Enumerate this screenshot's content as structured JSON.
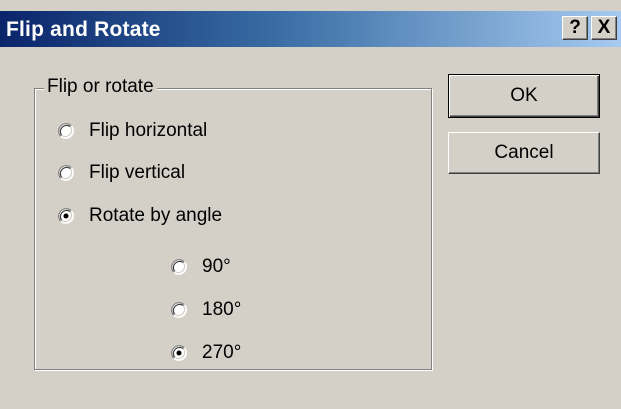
{
  "window": {
    "title": "Flip and Rotate",
    "help_label": "?",
    "close_label": "X"
  },
  "group": {
    "label": "Flip or rotate",
    "options": [
      {
        "label": "Flip horizontal",
        "selected": false
      },
      {
        "label": "Flip vertical",
        "selected": false
      },
      {
        "label": "Rotate by angle",
        "selected": true
      }
    ],
    "angles": [
      {
        "label": "90°",
        "selected": false
      },
      {
        "label": "180°",
        "selected": false
      },
      {
        "label": "270°",
        "selected": true
      }
    ]
  },
  "buttons": {
    "ok_label": "OK",
    "cancel_label": "Cancel"
  },
  "colors": {
    "titlebar_start": "#0a246a",
    "titlebar_end": "#a6caf0",
    "face": "#d4d0c8"
  }
}
